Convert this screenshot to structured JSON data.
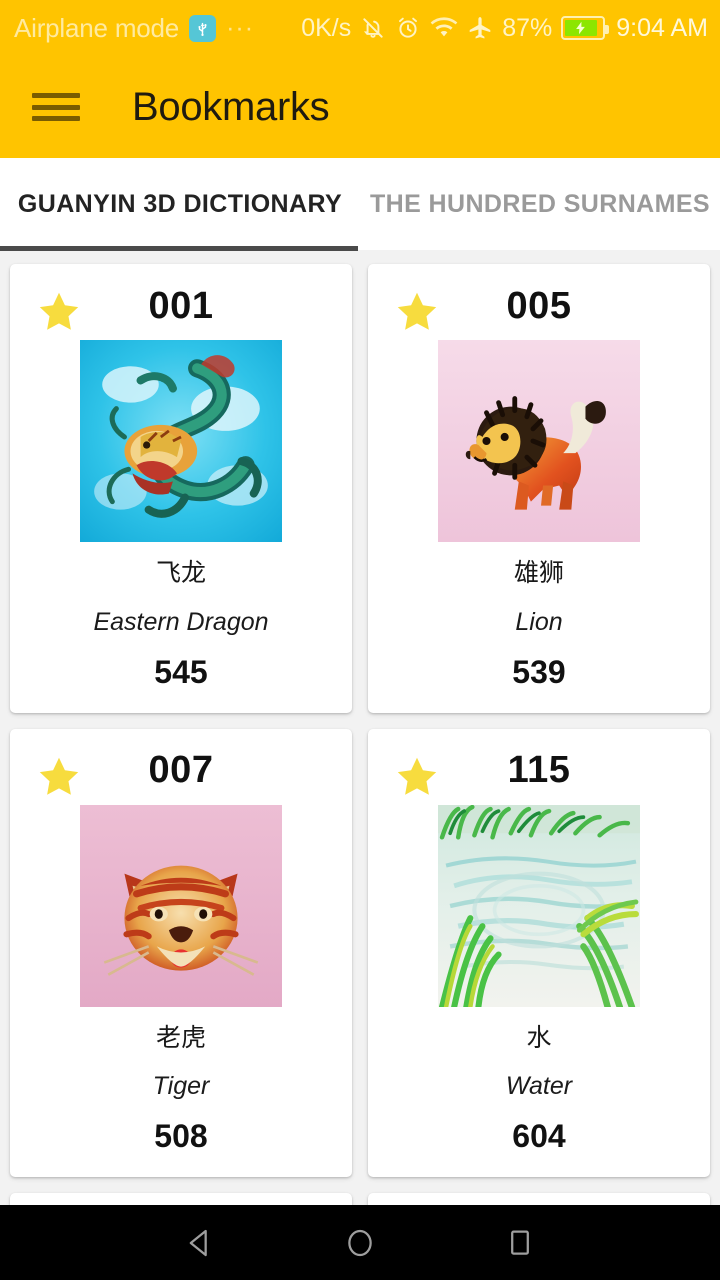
{
  "status_bar": {
    "left_text": "Airplane mode",
    "usb_icon": "usb-icon",
    "overflow_dots": "···",
    "network_speed": "0K/s",
    "mute_icon": "mute-bell-icon",
    "alarm_icon": "alarm-clock-icon",
    "wifi_icon": "wifi-icon",
    "airplane_icon": "airplane-icon",
    "battery_percent": "87%",
    "battery_icon": "battery-charging-icon",
    "clock": "9:04 AM"
  },
  "app_bar": {
    "menu_icon": "hamburger-menu-icon",
    "title": "Bookmarks"
  },
  "tabs": [
    {
      "label": "GUANYIN 3D DICTIONARY",
      "active": true
    },
    {
      "label": "THE HUNDRED SURNAMES",
      "active": false
    }
  ],
  "cards": [
    {
      "index": "001",
      "chinese_name": "飞龙",
      "english_name": "Eastern Dragon",
      "number": "545",
      "bookmarked": true,
      "star_icon": "star-filled-icon",
      "image": "eastern-dragon-thumbnail",
      "image_bg": "#29BEE4"
    },
    {
      "index": "005",
      "chinese_name": "雄狮",
      "english_name": "Lion",
      "number": "539",
      "bookmarked": true,
      "star_icon": "star-filled-icon",
      "image": "lion-thumbnail",
      "image_bg": "#F2CFE0"
    },
    {
      "index": "007",
      "chinese_name": "老虎",
      "english_name": "Tiger",
      "number": "508",
      "bookmarked": true,
      "star_icon": "star-filled-icon",
      "image": "tiger-thumbnail",
      "image_bg": "#EEBBD0"
    },
    {
      "index": "115",
      "chinese_name": "水",
      "english_name": "Water",
      "number": "604",
      "bookmarked": true,
      "star_icon": "star-filled-icon",
      "image": "water-thumbnail",
      "image_bg": "#DCEFE4"
    }
  ],
  "nav_bar": {
    "back_icon": "back-triangle-icon",
    "home_icon": "home-circle-icon",
    "recents_icon": "recents-square-icon"
  },
  "colors": {
    "accent": "#FFC400",
    "star": "#F7DC3E",
    "page_bg": "#F2F2F2",
    "card_bg": "#FFFFFF",
    "tab_active": "#232323",
    "tab_inactive": "#9A9A9A",
    "tab_indicator": "#4A4A4A"
  }
}
